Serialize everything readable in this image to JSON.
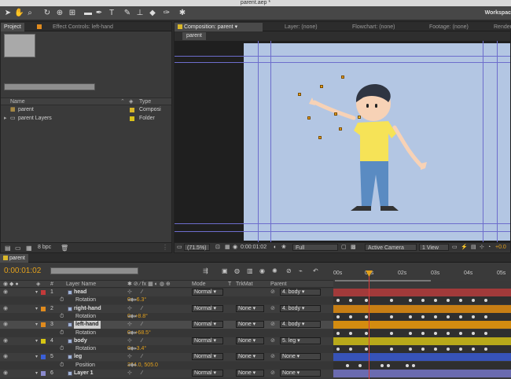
{
  "app": {
    "title": "parent.aep *",
    "workspace_label": "Workspac"
  },
  "toolbar": {
    "tools": [
      "selection-tool",
      "hand-tool",
      "zoom-tool",
      "rotate-tool",
      "camera-tool",
      "pan-behind-tool",
      "rectangle-tool",
      "pen-tool",
      "type-tool",
      "brush-tool",
      "clone-stamp-tool",
      "eraser-tool",
      "roto-brush-tool",
      "puppet-tool"
    ]
  },
  "project_panel": {
    "tabs": [
      "Project",
      "Effect Controls: left-hand"
    ],
    "columns": {
      "name": "Name",
      "type": "Type"
    },
    "items": [
      {
        "name": "parent",
        "type": "Composi",
        "color": "#d9b72a"
      },
      {
        "name": "parent Layers",
        "type": "Folder",
        "color": "#d9c21a"
      }
    ],
    "footer_bpc": "8 bpc"
  },
  "composition_panel": {
    "tabs": [
      "Composition: parent",
      "Layer: (none)",
      "Flowchart: (none)",
      "Footage: (none)",
      "Render"
    ],
    "subtab": "parent",
    "viewer_bar": {
      "zoom": "(71.5%)",
      "timecode": "0:00:01:02",
      "resolution": "Full",
      "camera": "Active Camera",
      "views": "1 View",
      "exposure": "+0.0"
    },
    "background_color": "#b3c6e3"
  },
  "timeline": {
    "tab": "parent",
    "current_time": "0:00:01:02",
    "headers": {
      "layer_name": "Layer Name",
      "mode": "Mode",
      "t": "T",
      "trkmat": "TrkMat",
      "parent": "Parent"
    },
    "ruler": [
      "00s",
      "01s",
      "02s",
      "03s",
      "04s",
      "05s"
    ],
    "rows": [
      {
        "kind": "layer",
        "num": "1",
        "name": "head",
        "color": "#c33a3a",
        "mode": "Normal",
        "trkmat": "",
        "parent": "4. body",
        "bar_color": "#a23a3a"
      },
      {
        "kind": "prop",
        "name": "Rotation",
        "value": "0x -6.3°",
        "keys": [
          0,
          16,
          36,
          68,
          92,
          108,
          124,
          140,
          156,
          172,
          188
        ]
      },
      {
        "kind": "layer",
        "num": "2",
        "name": "right-hand",
        "color": "#e08b1e",
        "mode": "Normal",
        "trkmat": "None",
        "parent": "4. body",
        "bar_color": "#c77e14"
      },
      {
        "kind": "prop",
        "name": "Rotation",
        "value": "0x +8.8°",
        "keys": [
          0,
          16,
          36,
          68,
          92,
          108,
          124,
          140,
          156,
          172,
          188
        ]
      },
      {
        "kind": "layer",
        "num": "3",
        "name": "left-hand",
        "color": "#e08b1e",
        "mode": "Normal",
        "trkmat": "None",
        "parent": "4. body",
        "bar_color": "#d48c10",
        "selected": true
      },
      {
        "kind": "prop",
        "name": "Rotation",
        "value": "0x +68.5°",
        "keys": [
          0,
          16,
          36,
          68,
          92,
          108,
          124,
          140,
          156,
          172,
          188
        ]
      },
      {
        "kind": "layer",
        "num": "4",
        "name": "body",
        "color": "#d6c514",
        "mode": "Normal",
        "trkmat": "None",
        "parent": "5. leg",
        "bar_color": "#b8a91a"
      },
      {
        "kind": "prop",
        "name": "Rotation",
        "value": "0x -3.4°",
        "keys": [
          0,
          16,
          36,
          68,
          92,
          108,
          124,
          140,
          156,
          172,
          188
        ]
      },
      {
        "kind": "layer",
        "num": "5",
        "name": "leg",
        "color": "#3a5fd6",
        "mode": "Normal",
        "trkmat": "None",
        "parent": "None",
        "bar_color": "#3753b8"
      },
      {
        "kind": "prop",
        "name": "Position",
        "value": "364.0, 505.0",
        "keys": [
          12,
          28,
          56,
          64,
          88,
          96
        ]
      },
      {
        "kind": "layer",
        "num": "6",
        "name": "Layer 1",
        "color": "#8a8acc",
        "mode": "Normal",
        "trkmat": "None",
        "parent": "None",
        "bar_color": "#6b6bb0"
      }
    ]
  }
}
